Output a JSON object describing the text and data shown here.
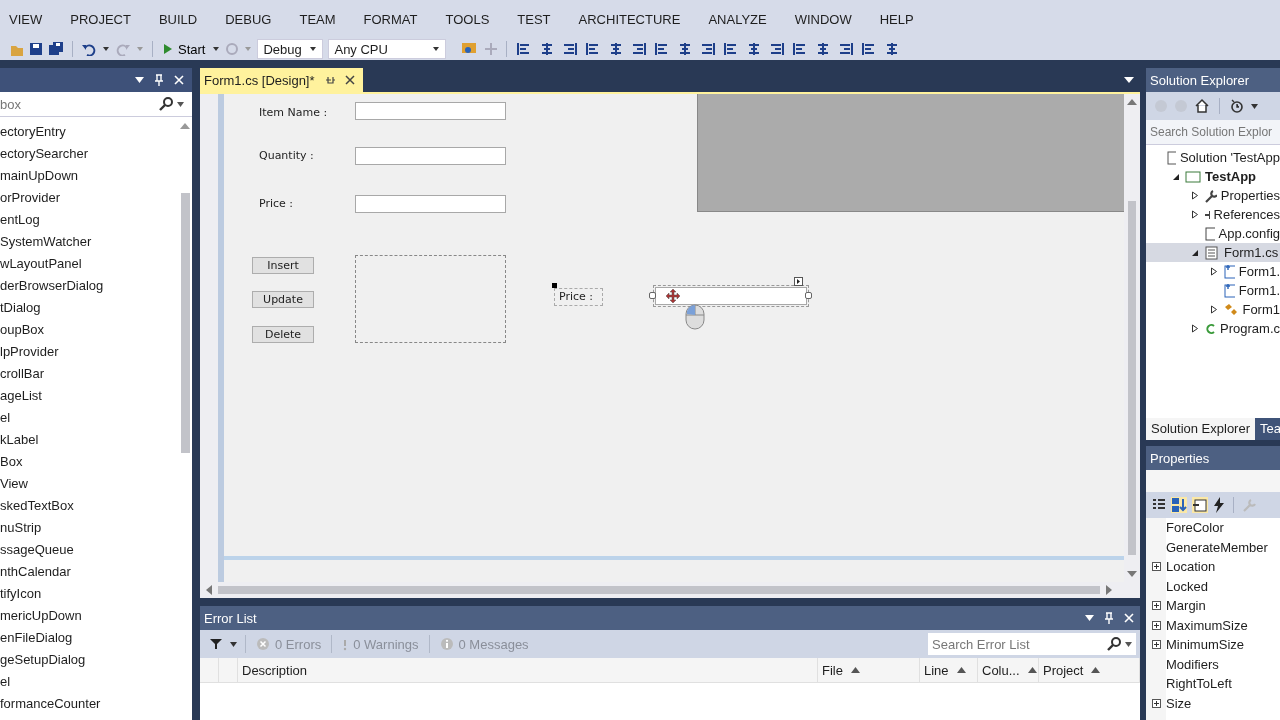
{
  "menu": [
    "VIEW",
    "PROJECT",
    "BUILD",
    "DEBUG",
    "TEAM",
    "FORMAT",
    "TOOLS",
    "TEST",
    "ARCHITECTURE",
    "ANALYZE",
    "WINDOW",
    "HELP"
  ],
  "toolbar": {
    "start": "Start",
    "configuration": "Debug",
    "platform": "Any CPU"
  },
  "toolbox": {
    "search_placeholder": "box",
    "items": [
      "ectoryEntry",
      "ectorySearcher",
      "mainUpDown",
      "orProvider",
      "entLog",
      "SystemWatcher",
      "wLayoutPanel",
      "derBrowserDialog",
      "tDialog",
      "oupBox",
      "lpProvider",
      "crollBar",
      "ageList",
      "el",
      "kLabel",
      "Box",
      "View",
      "skedTextBox",
      "nuStrip",
      "ssageQueue",
      "nthCalendar",
      "tifyIcon",
      "mericUpDown",
      "enFileDialog",
      "geSetupDialog",
      "el",
      "formanceCounter"
    ]
  },
  "document_tab": {
    "title": "Form1.cs [Design]*"
  },
  "form": {
    "fields": [
      {
        "label": "Item Name :"
      },
      {
        "label": "Quantity :"
      },
      {
        "label": "Price :"
      }
    ],
    "buttons": [
      "Insert",
      "Update",
      "Delete"
    ],
    "selected_label": "Price :"
  },
  "error_list": {
    "title": "Error List",
    "errors": "0 Errors",
    "warnings": "0 Warnings",
    "messages": "0 Messages",
    "search_placeholder": "Search Error List",
    "columns": [
      {
        "label": "Description",
        "sortable": false
      },
      {
        "label": "File",
        "sortable": true
      },
      {
        "label": "Line",
        "sortable": true
      },
      {
        "label": "Colu...",
        "sortable": true
      },
      {
        "label": "Project",
        "sortable": true
      }
    ]
  },
  "solution_explorer": {
    "title": "Solution Explorer",
    "search_placeholder": "Search Solution Explor",
    "tree": [
      {
        "label": "Solution 'TestApp",
        "kind": "solution",
        "expandable": false,
        "selected": false,
        "bold": false,
        "children": [
          {
            "label": "TestApp",
            "kind": "project",
            "expandable": true,
            "expanded": true,
            "selected": false,
            "bold": true,
            "children": [
              {
                "label": "Properties",
                "kind": "settings",
                "expandable": true,
                "expanded": false,
                "selected": false,
                "bold": false
              },
              {
                "label": "References",
                "kind": "references",
                "expandable": true,
                "expanded": false,
                "selected": false,
                "bold": false
              },
              {
                "label": "App.config",
                "kind": "config",
                "expandable": false,
                "selected": false,
                "bold": false
              },
              {
                "label": "Form1.cs",
                "kind": "form",
                "expandable": true,
                "expanded": true,
                "selected": true,
                "bold": false,
                "children": [
                  {
                    "label": "Form1.",
                    "kind": "file",
                    "expandable": true,
                    "expanded": false,
                    "selected": false,
                    "bold": false
                  },
                  {
                    "label": "Form1.",
                    "kind": "file",
                    "expandable": false,
                    "selected": false,
                    "bold": false
                  },
                  {
                    "label": "Form1",
                    "kind": "class",
                    "expandable": true,
                    "expanded": false,
                    "selected": false,
                    "bold": false
                  }
                ]
              },
              {
                "label": "Program.c",
                "kind": "code",
                "expandable": true,
                "expanded": false,
                "selected": false,
                "bold": false
              }
            ]
          }
        ]
      }
    ],
    "tabs": [
      {
        "label": "Solution Explorer",
        "selected": true
      },
      {
        "label": "Tea",
        "selected": false
      }
    ]
  },
  "properties": {
    "title": "Properties",
    "rows": [
      {
        "name": "ForeColor",
        "expandable": false
      },
      {
        "name": "GenerateMember",
        "expandable": false
      },
      {
        "name": "Location",
        "expandable": true
      },
      {
        "name": "Locked",
        "expandable": false
      },
      {
        "name": "Margin",
        "expandable": true
      },
      {
        "name": "MaximumSize",
        "expandable": true
      },
      {
        "name": "MinimumSize",
        "expandable": true
      },
      {
        "name": "Modifiers",
        "expandable": false
      },
      {
        "name": "RightToLeft",
        "expandable": false
      },
      {
        "name": "Size",
        "expandable": true
      }
    ]
  }
}
